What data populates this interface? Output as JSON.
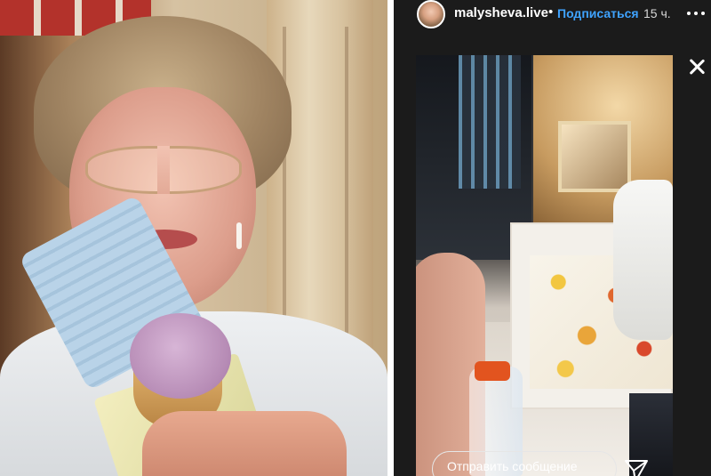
{
  "story": {
    "username": "malysheva.live",
    "separator": "•",
    "follow_label": "Подписаться",
    "time_ago": "15 ч.",
    "reply_placeholder": "Отправить сообщение"
  },
  "icons": {
    "more": "more-options-icon",
    "close": "close-icon",
    "send": "send-icon"
  },
  "colors": {
    "story_background": "#1b1b1b",
    "follow_link": "#3fa3ff"
  }
}
